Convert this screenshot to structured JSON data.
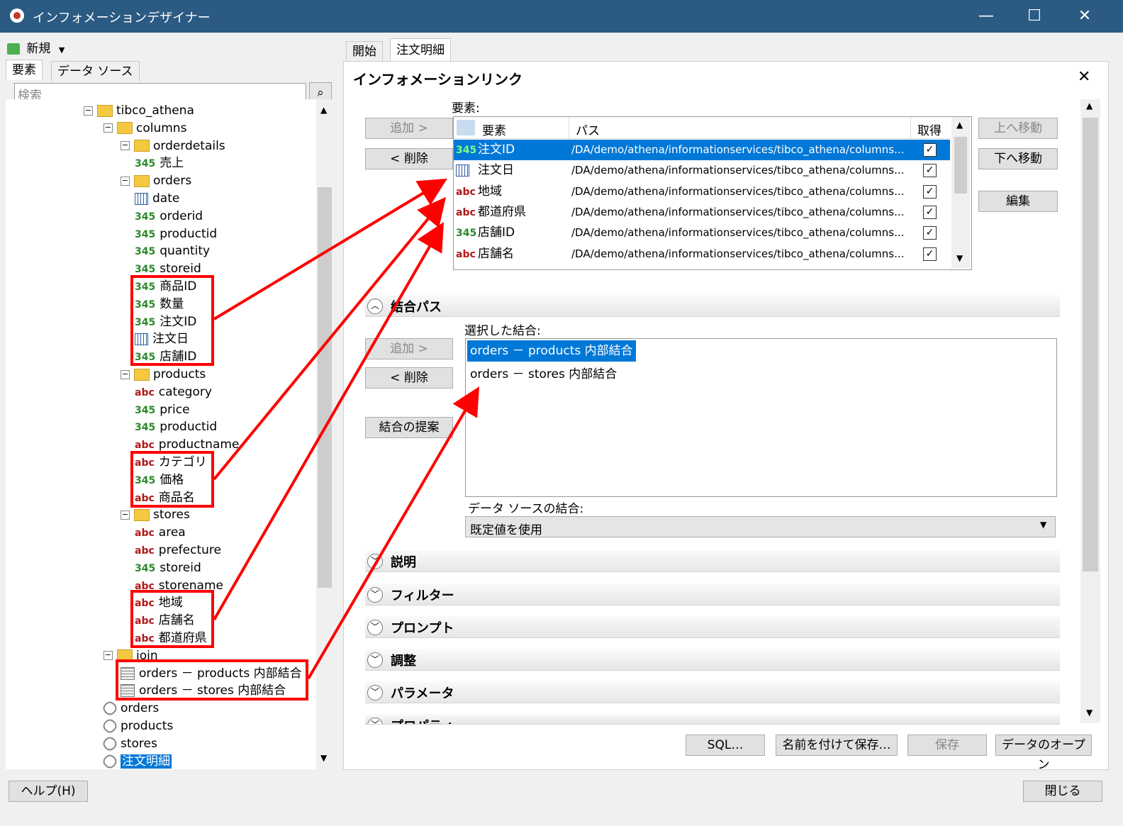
{
  "window": {
    "title": "インフォメーションデザイナー"
  },
  "left": {
    "new_label": "新規",
    "tabs": [
      "要素",
      "データ ソース"
    ],
    "search_placeholder": "検索",
    "tree": [
      {
        "label": "tibco_athena",
        "kind": "folder"
      },
      {
        "label": "columns",
        "kind": "folder"
      },
      {
        "label": "orderdetails",
        "kind": "folder"
      },
      {
        "label": "売上",
        "kind": "345"
      },
      {
        "label": "orders",
        "kind": "folder"
      },
      {
        "label": "date",
        "kind": "date"
      },
      {
        "label": "orderid",
        "kind": "345"
      },
      {
        "label": "productid",
        "kind": "345"
      },
      {
        "label": "quantity",
        "kind": "345"
      },
      {
        "label": "storeid",
        "kind": "345"
      },
      {
        "label": "商品ID",
        "kind": "345"
      },
      {
        "label": "数量",
        "kind": "345"
      },
      {
        "label": "注文ID",
        "kind": "345"
      },
      {
        "label": "注文日",
        "kind": "date"
      },
      {
        "label": "店舗ID",
        "kind": "345"
      },
      {
        "label": "products",
        "kind": "folder"
      },
      {
        "label": "category",
        "kind": "abc"
      },
      {
        "label": "price",
        "kind": "345"
      },
      {
        "label": "productid",
        "kind": "345"
      },
      {
        "label": "productname",
        "kind": "abc"
      },
      {
        "label": "カテゴリ",
        "kind": "abc"
      },
      {
        "label": "価格",
        "kind": "345"
      },
      {
        "label": "商品名",
        "kind": "abc"
      },
      {
        "label": "stores",
        "kind": "folder"
      },
      {
        "label": "area",
        "kind": "abc"
      },
      {
        "label": "prefecture",
        "kind": "abc"
      },
      {
        "label": "storeid",
        "kind": "345"
      },
      {
        "label": "storename",
        "kind": "abc"
      },
      {
        "label": "地域",
        "kind": "abc"
      },
      {
        "label": "店舗名",
        "kind": "abc"
      },
      {
        "label": "都道府県",
        "kind": "abc"
      },
      {
        "label": "join",
        "kind": "folder"
      },
      {
        "label": "orders － products 内部結合",
        "kind": "join"
      },
      {
        "label": "orders － stores 内部結合",
        "kind": "join"
      },
      {
        "label": "orders",
        "kind": "link"
      },
      {
        "label": "products",
        "kind": "link"
      },
      {
        "label": "stores",
        "kind": "link"
      },
      {
        "label": "注文明細",
        "kind": "link",
        "selected": true
      }
    ],
    "help_label": "ヘルプ(H)"
  },
  "right": {
    "tabs": [
      "開始",
      "注文明細"
    ],
    "panel_title": "インフォメーションリンク",
    "elements_label": "要素:",
    "add_label": "追加 >",
    "remove_label": "< 削除",
    "up_label": "上へ移動",
    "down_label": "下へ移動",
    "edit_label": "編集",
    "columns": [
      "要素",
      "パス",
      "取得"
    ],
    "elements": [
      {
        "icon": "345",
        "name": "注文ID",
        "path": "/DA/demo/athena/informationservices/tibco_athena/columns...",
        "checked": true
      },
      {
        "icon": "date",
        "name": "注文日",
        "path": "/DA/demo/athena/informationservices/tibco_athena/columns...",
        "checked": true
      },
      {
        "icon": "abc",
        "name": "地域",
        "path": "/DA/demo/athena/informationservices/tibco_athena/columns...",
        "checked": true
      },
      {
        "icon": "abc",
        "name": "都道府県",
        "path": "/DA/demo/athena/informationservices/tibco_athena/columns...",
        "checked": true
      },
      {
        "icon": "345",
        "name": "店舗ID",
        "path": "/DA/demo/athena/informationservices/tibco_athena/columns...",
        "checked": true
      },
      {
        "icon": "abc",
        "name": "店舗名",
        "path": "/DA/demo/athena/informationservices/tibco_athena/columns...",
        "checked": true
      }
    ],
    "join_section": "結合パス",
    "selected_joins_label": "選択した結合:",
    "joins": [
      "orders － products 内部結合",
      "orders － stores 内部結合"
    ],
    "suggest_label": "結合の提案",
    "ds_join_label": "データ ソースの結合:",
    "ds_join_value": "既定値を使用",
    "sections": [
      "説明",
      "フィルター",
      "プロンプト",
      "調整",
      "パラメータ",
      "プロパティ"
    ],
    "footer": {
      "sql": "SQL…",
      "save_as": "名前を付けて保存…",
      "save": "保存",
      "open": "データのオープン"
    },
    "close_label": "閉じる"
  },
  "colors": {
    "titlebar": "#2b5a83",
    "selection": "#0078d7",
    "annotation": "#ff0000",
    "num": "#2a8a2a",
    "str": "#b01818"
  }
}
